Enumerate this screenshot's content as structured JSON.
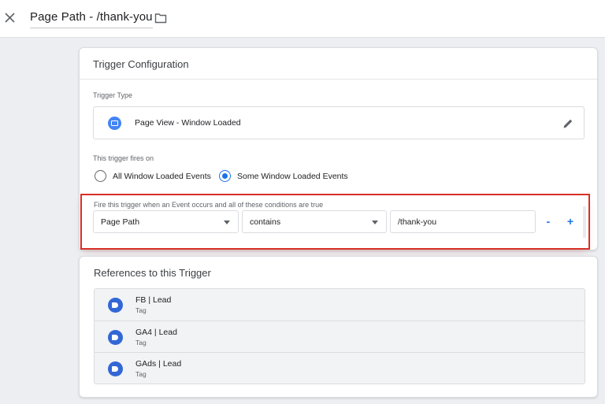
{
  "header": {
    "title": "Page Path - /thank-you"
  },
  "trigger_config": {
    "heading": "Trigger Configuration",
    "trigger_type_label": "Trigger Type",
    "trigger_type_value": "Page View - Window Loaded",
    "fires_on_label": "This trigger fires on",
    "options": [
      {
        "label": "All Window Loaded Events",
        "selected": false
      },
      {
        "label": "Some Window Loaded Events",
        "selected": true
      }
    ],
    "conditions_label": "Fire this trigger when an Event occurs and all of these conditions are true",
    "condition": {
      "variable": "Page Path",
      "operator": "contains",
      "value": "/thank-you",
      "remove_label": "-",
      "add_label": "+"
    }
  },
  "references": {
    "heading": "References to this Trigger",
    "items": [
      {
        "name": "FB | Lead",
        "type": "Tag"
      },
      {
        "name": "GA4 | Lead",
        "type": "Tag"
      },
      {
        "name": "GAds | Lead",
        "type": "Tag"
      }
    ]
  },
  "colors": {
    "accent": "#1a73e8",
    "highlight_border": "#d93025",
    "tag_icon": "#3367d6"
  },
  "icons": [
    "close-icon",
    "folder-icon",
    "page-view-icon",
    "pencil-icon",
    "tag-icon"
  ]
}
